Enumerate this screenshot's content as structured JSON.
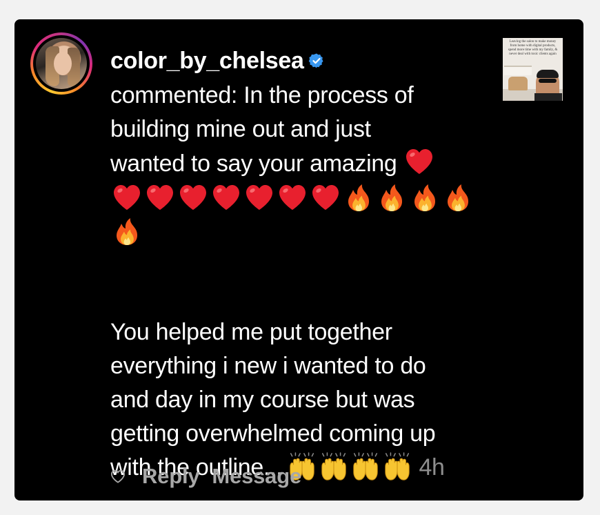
{
  "comment": {
    "username": "color_by_chelsea",
    "verified": true,
    "lines": [
      "commented: In the process of",
      "building mine out and just",
      "wanted to say your amazing"
    ],
    "emojis_line1_tail": [
      "red-heart"
    ],
    "emojis_line2": [
      "red-heart",
      "red-heart",
      "red-heart",
      "red-heart",
      "red-heart",
      "red-heart",
      "red-heart",
      "fire",
      "fire",
      "fire",
      "fire"
    ],
    "emojis_line3": [
      "fire"
    ],
    "paragraph2": [
      "You helped me put together",
      "everything i new i wanted to do",
      "and day in my course but was",
      "getting overwhelmed coming up",
      "with the outline..."
    ],
    "emojis_end": [
      "raising-hands",
      "raising-hands",
      "raising-hands",
      "raising-hands"
    ],
    "time": "4h"
  },
  "thumbnail": {
    "caption": "Leaving the salon to make money from home with digital products, spend more time with my family, & never deal with toxic clients again"
  },
  "actions": {
    "like_icon": "heart-outline-icon",
    "reply_label": "Reply",
    "message_label": "Message"
  },
  "colors": {
    "background": "#000000",
    "text": "#ffffff",
    "muted": "#a8a8a8",
    "verified": "#3897f0"
  }
}
